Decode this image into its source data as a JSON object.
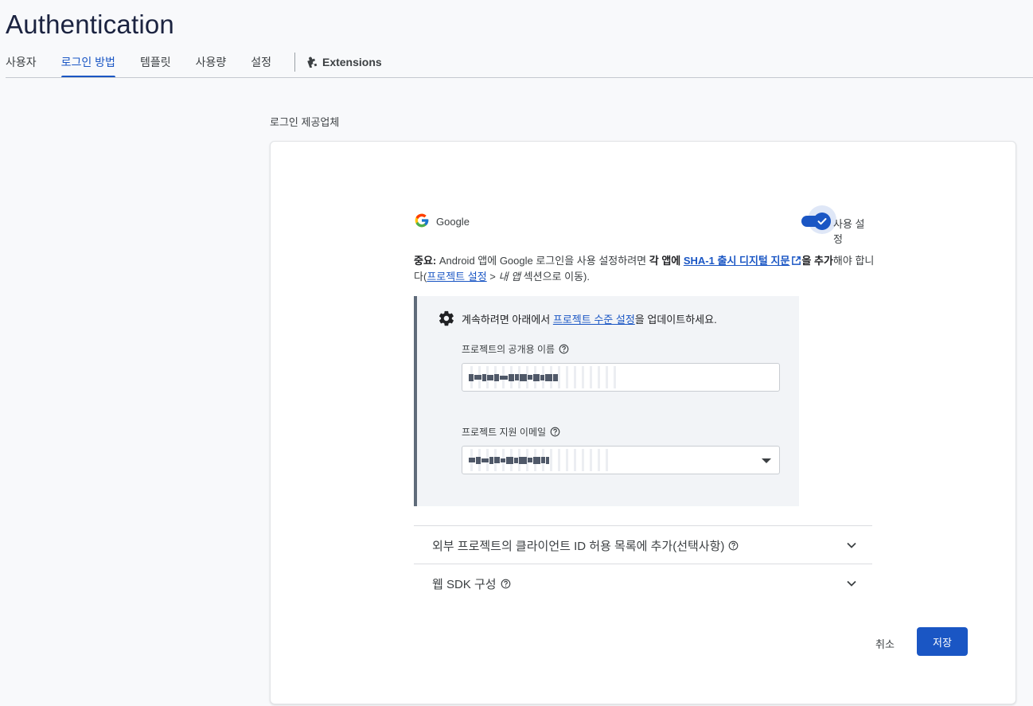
{
  "header": {
    "title": "Authentication"
  },
  "tabs": [
    {
      "label": "사용자"
    },
    {
      "label": "로그인 방법"
    },
    {
      "label": "템플릿"
    },
    {
      "label": "사용량"
    },
    {
      "label": "설정"
    },
    {
      "label": "Extensions"
    }
  ],
  "section": {
    "label": "로그인 제공업체"
  },
  "provider": {
    "name": "Google",
    "enabled_label": "사용 설정",
    "enabled": true
  },
  "notice": {
    "lead": "중요:",
    "text1": " Android 앱에 Google 로그인을 사용 설정하려면 ",
    "bold1": "각 앱에 ",
    "link": "SHA-1 출시 디지털 지문",
    "bold2": "을 추가",
    "text2": "해야 합니다(",
    "link2": "프로젝트 설정",
    "text3": " > ",
    "italic": "내 앱",
    "text4": " 섹션으로 이동)."
  },
  "settings_box": {
    "message_pre": "계속하려면 아래에서 ",
    "message_link": "프로젝트 수준 설정",
    "message_post": "을 업데이트하세요.",
    "public_name_label": "프로젝트의 공개용 이름",
    "support_email_label": "프로젝트 지원 이메일"
  },
  "expanders": [
    {
      "title": "외부 프로젝트의 클라이언트 ID 허용 목록에 추가(선택사항)"
    },
    {
      "title": "웹 SDK 구성"
    }
  ],
  "actions": {
    "cancel": "취소",
    "save": "저장"
  },
  "colors": {
    "accent": "#1a56c4",
    "box_border": "#5f6b7a"
  }
}
